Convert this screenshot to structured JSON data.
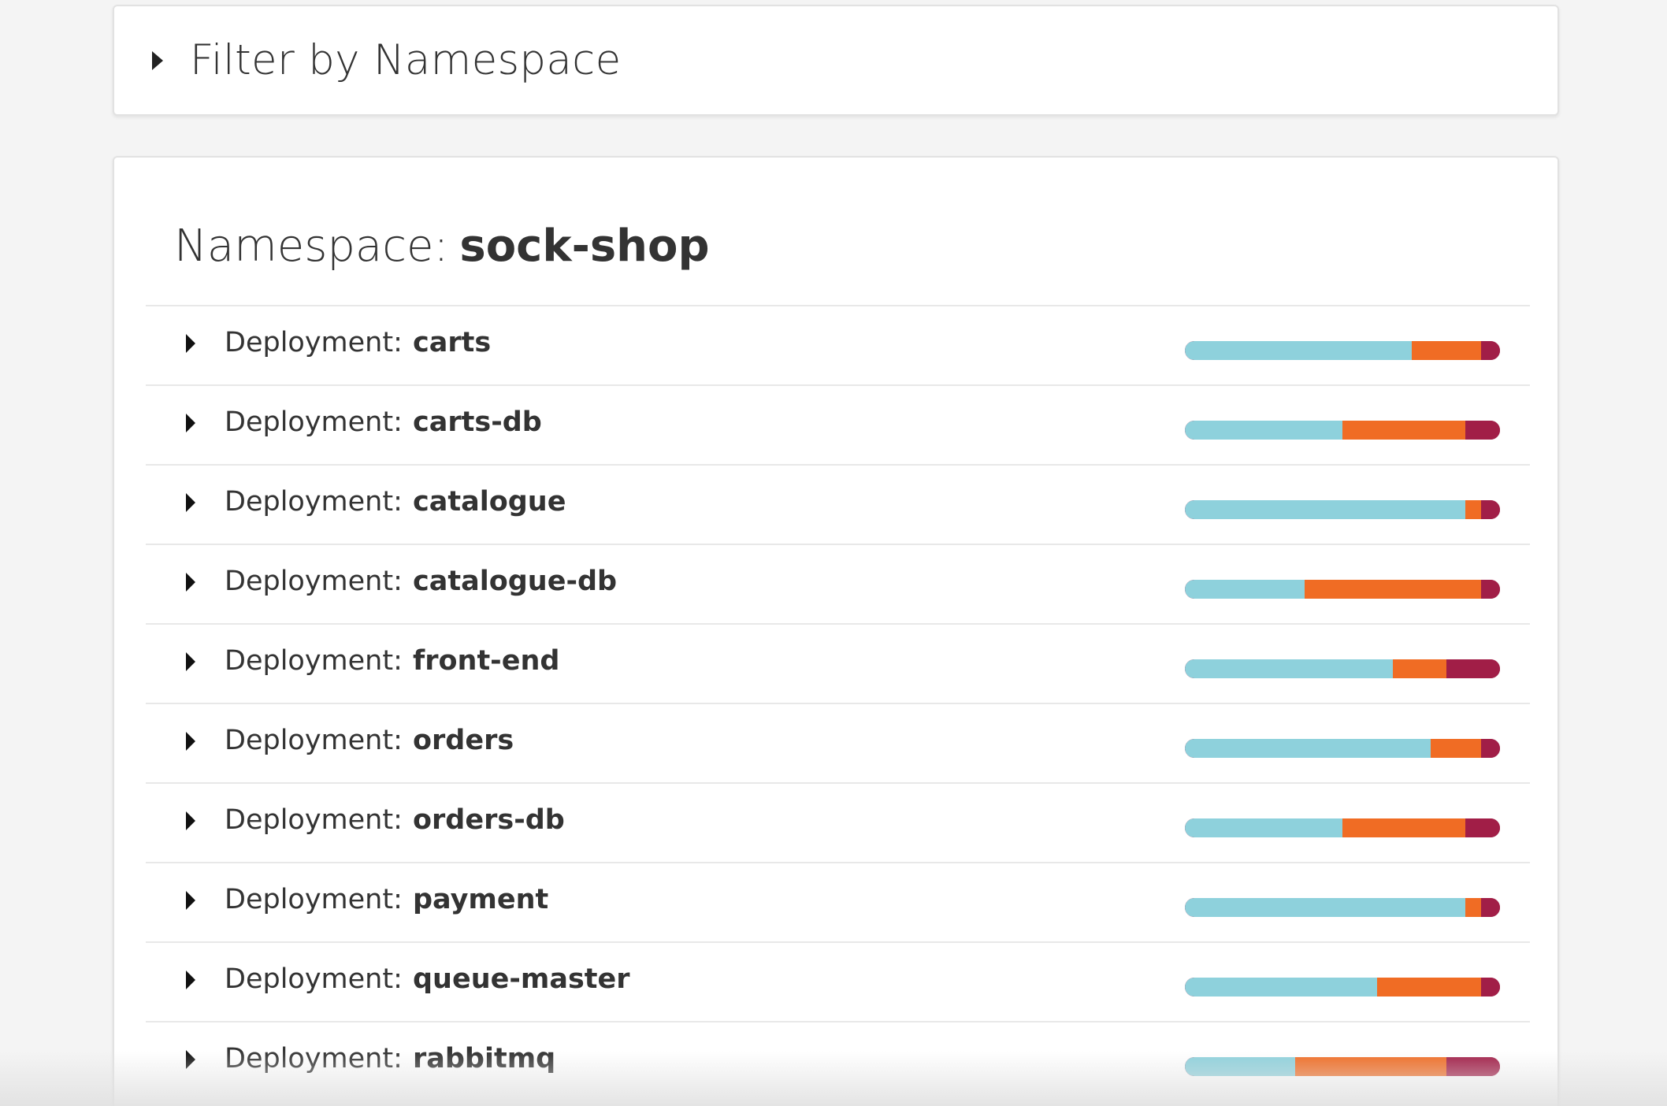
{
  "filter": {
    "title": "Filter by Namespace"
  },
  "namespace": {
    "label": "Namespace:",
    "name": "sock-shop"
  },
  "colors": {
    "segment_a": "#8ed1dc",
    "segment_b": "#f06c24",
    "segment_c": "#a11e47"
  },
  "deployments": [
    {
      "label": "Deployment:",
      "name": "carts",
      "fractions": [
        0.72,
        0.22,
        0.06
      ]
    },
    {
      "label": "Deployment:",
      "name": "carts-db",
      "fractions": [
        0.5,
        0.39,
        0.11
      ]
    },
    {
      "label": "Deployment:",
      "name": "catalogue",
      "fractions": [
        0.89,
        0.05,
        0.06
      ]
    },
    {
      "label": "Deployment:",
      "name": "catalogue-db",
      "fractions": [
        0.38,
        0.56,
        0.06
      ]
    },
    {
      "label": "Deployment:",
      "name": "front-end",
      "fractions": [
        0.66,
        0.17,
        0.17
      ]
    },
    {
      "label": "Deployment:",
      "name": "orders",
      "fractions": [
        0.78,
        0.16,
        0.06
      ]
    },
    {
      "label": "Deployment:",
      "name": "orders-db",
      "fractions": [
        0.5,
        0.39,
        0.11
      ]
    },
    {
      "label": "Deployment:",
      "name": "payment",
      "fractions": [
        0.89,
        0.05,
        0.06
      ]
    },
    {
      "label": "Deployment:",
      "name": "queue-master",
      "fractions": [
        0.61,
        0.33,
        0.06
      ]
    },
    {
      "label": "Deployment:",
      "name": "rabbitmq",
      "fractions": [
        0.35,
        0.48,
        0.17
      ]
    }
  ]
}
